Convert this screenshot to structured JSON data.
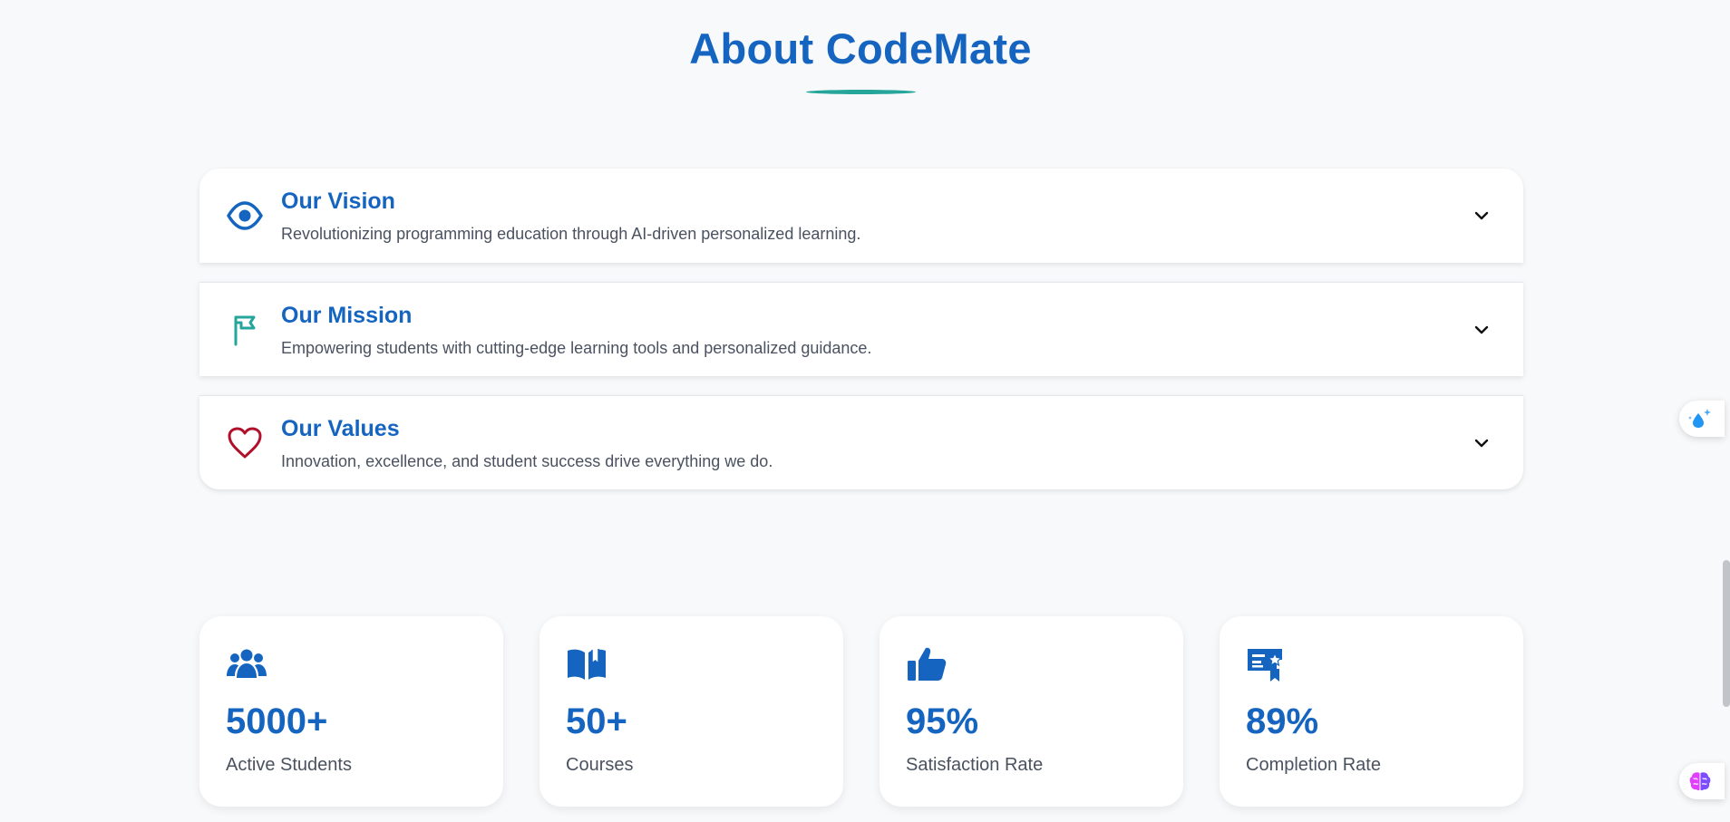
{
  "section": {
    "title": "About CodeMate"
  },
  "accordion": [
    {
      "title": "Our Vision",
      "description": "Revolutionizing programming education through AI-driven personalized learning.",
      "icon": "eye-icon",
      "icon_color": "#1565c0"
    },
    {
      "title": "Our Mission",
      "description": "Empowering students with cutting-edge learning tools and personalized guidance.",
      "icon": "flag-icon",
      "icon_color": "#26a69a"
    },
    {
      "title": "Our Values",
      "description": "Innovation, excellence, and student success drive everything we do.",
      "icon": "heart-icon",
      "icon_color": "#b0102a"
    }
  ],
  "stats": [
    {
      "value": "5000+",
      "label": "Active Students",
      "icon": "users-icon"
    },
    {
      "value": "50+",
      "label": "Courses",
      "icon": "book-icon"
    },
    {
      "value": "95%",
      "label": "Satisfaction Rate",
      "icon": "thumbs-up-icon"
    },
    {
      "value": "89%",
      "label": "Completion Rate",
      "icon": "certificate-icon"
    }
  ],
  "floating_widgets": [
    {
      "icon": "sparkle-drop-icon"
    },
    {
      "icon": "brain-icon"
    }
  ],
  "colors": {
    "primary": "#1565c0",
    "accent": "#26a69a",
    "heart": "#b0102a",
    "background": "#f8f9fb"
  }
}
